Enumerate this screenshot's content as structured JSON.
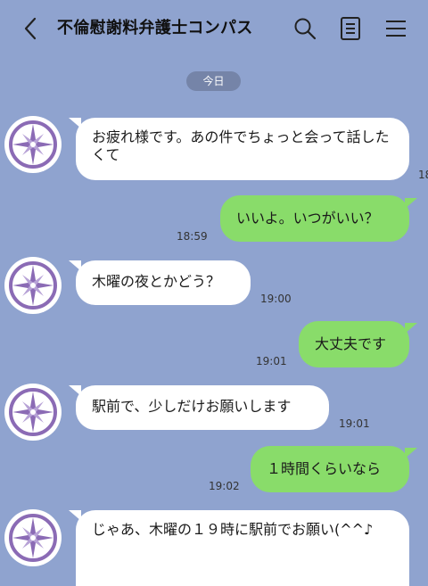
{
  "header": {
    "title": "不倫慰謝料弁護士コンパス",
    "back_icon": "chevron-left-icon",
    "search_icon": "search-icon",
    "notes_icon": "notes-icon",
    "menu_icon": "menu-icon"
  },
  "date_label": "今日",
  "colors": {
    "background": "#8fa3cf",
    "sent_bubble": "#89dc6a",
    "received_bubble": "#ffffff"
  },
  "messages": [
    {
      "side": "left",
      "text": "お疲れ様です。あの件でちょっと会って話したくて",
      "time": "18"
    },
    {
      "side": "right",
      "text": "いいよ。いつがいい？",
      "time": "18:59"
    },
    {
      "side": "left",
      "text": "木曜の夜とかどう？",
      "time": "19:00"
    },
    {
      "side": "right",
      "text": "大丈夫です",
      "time": "19:01"
    },
    {
      "side": "left",
      "text": "駅前で、少しだけお願いします",
      "time": "19:01"
    },
    {
      "side": "right",
      "text": "１時間くらいなら",
      "time": "19:02"
    },
    {
      "side": "left",
      "text": "じゃあ、木曜の１９時に駅前でお願い(^^♪",
      "time": ""
    }
  ]
}
